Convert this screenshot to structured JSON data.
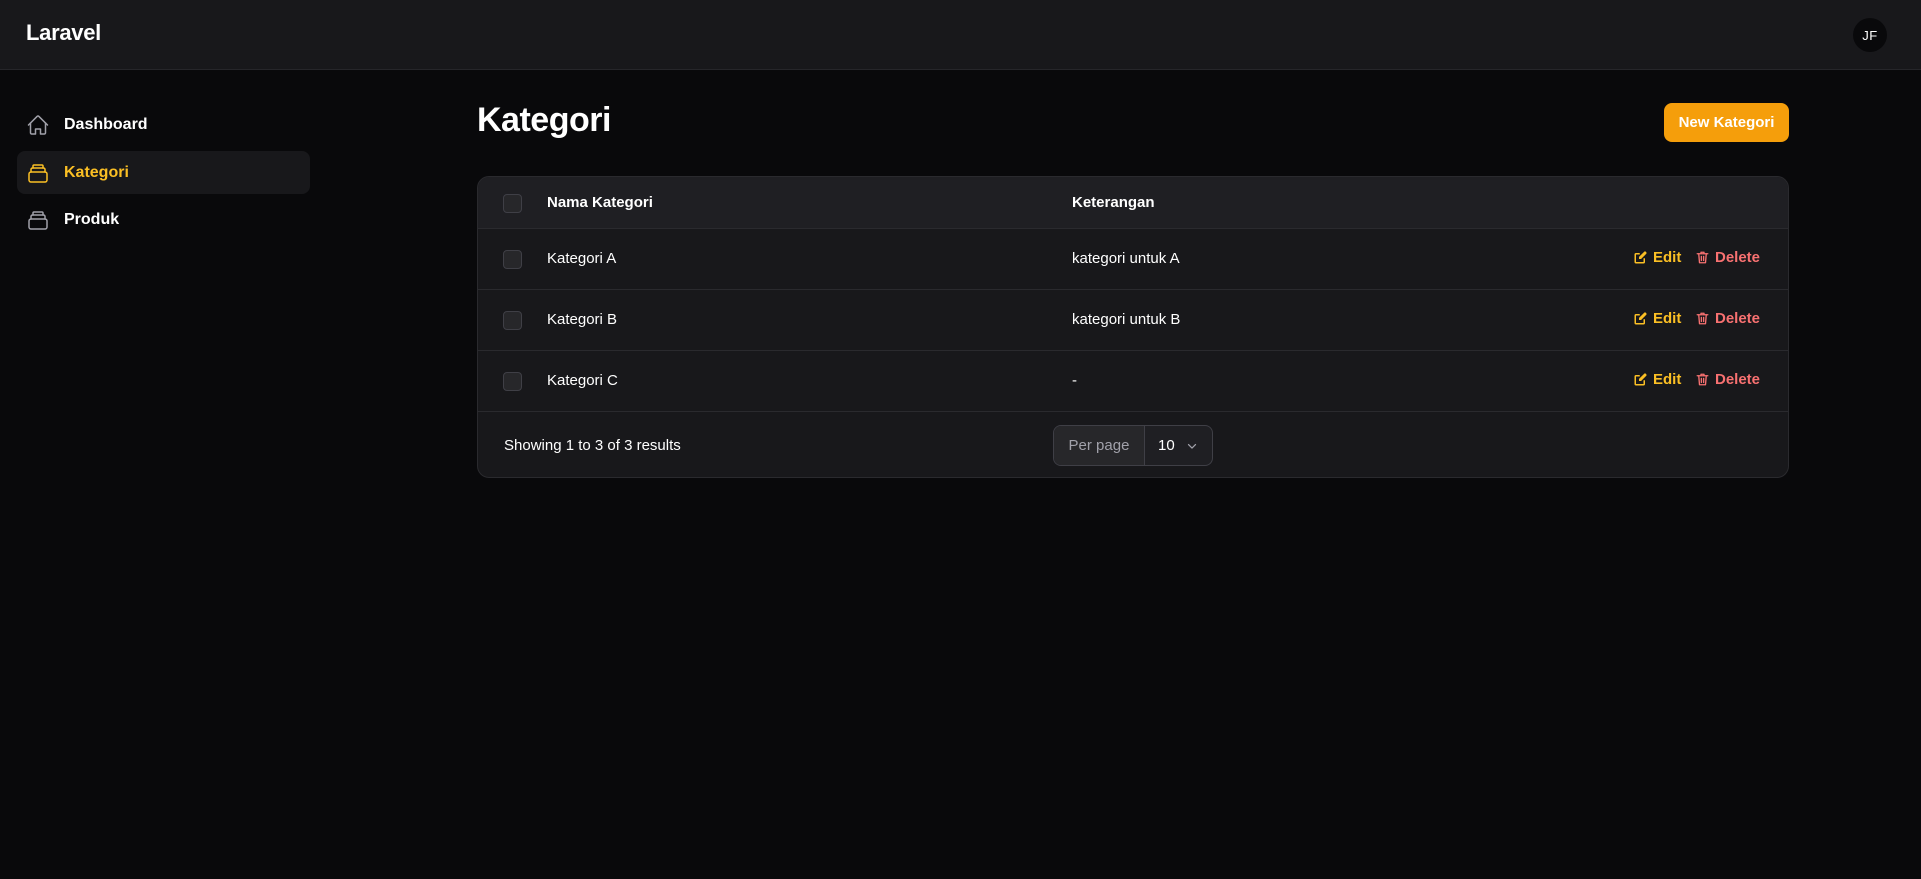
{
  "topbar": {
    "brand": "Laravel",
    "avatar_initials": "JF"
  },
  "sidebar": {
    "items": [
      {
        "label": "Dashboard",
        "icon": "home-icon",
        "active": false
      },
      {
        "label": "Kategori",
        "icon": "rectangle-stack-icon",
        "active": true
      },
      {
        "label": "Produk",
        "icon": "rectangle-stack-icon",
        "active": false
      }
    ]
  },
  "header": {
    "title": "Kategori",
    "new_button_label": "New Kategori"
  },
  "table": {
    "columns": [
      "Nama Kategori",
      "Keterangan"
    ],
    "rows": [
      {
        "nama": "Kategori A",
        "keterangan": "kategori untuk A"
      },
      {
        "nama": "Kategori B",
        "keterangan": "kategori untuk B"
      },
      {
        "nama": "Kategori C",
        "keterangan": "-"
      }
    ],
    "actions": {
      "edit_label": "Edit",
      "delete_label": "Delete"
    }
  },
  "pagination": {
    "results_text": "Showing 1 to 3 of 3 results",
    "per_page_label": "Per page",
    "per_page_value": "10"
  },
  "colors": {
    "accent": "#f59e0b",
    "active_text": "#fbbf24",
    "danger": "#f87171",
    "background": "#09090b",
    "surface": "#18181b"
  }
}
